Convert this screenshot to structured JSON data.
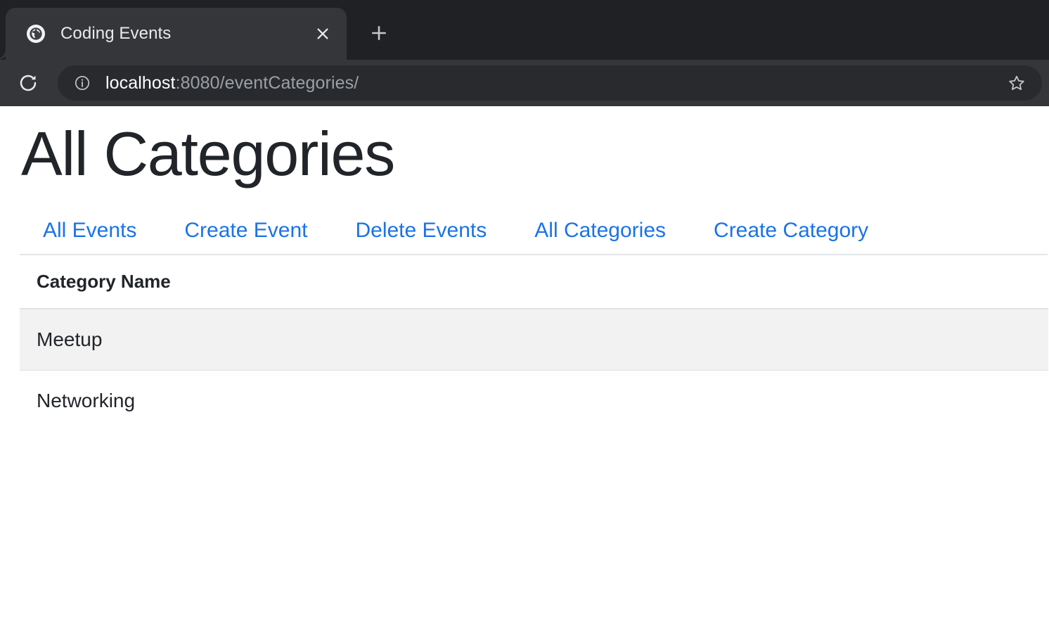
{
  "browser": {
    "tab": {
      "title": "Coding Events",
      "favicon_icon": "globe-icon",
      "close_icon": "close-icon"
    },
    "newtab_icon": "plus-icon",
    "reload_icon": "reload-icon",
    "omnibox": {
      "site_info_icon": "info-circle-icon",
      "url_host": "localhost",
      "url_rest": ":8080/eventCategories/",
      "bookmark_icon": "star-icon"
    }
  },
  "page": {
    "title": "All Categories",
    "nav": [
      {
        "label": "All Events"
      },
      {
        "label": "Create Event"
      },
      {
        "label": "Delete Events"
      },
      {
        "label": "All Categories"
      },
      {
        "label": "Create Category"
      }
    ],
    "table": {
      "columns": [
        "Category Name"
      ],
      "rows": [
        {
          "name": "Meetup"
        },
        {
          "name": "Networking"
        }
      ]
    }
  },
  "colors": {
    "link": "#1a73e8",
    "text": "#212529",
    "chrome_bg": "#202124",
    "toolbar_bg": "#35363a",
    "omnibox_bg": "#292a2d",
    "row_striped": "#f2f2f2",
    "border": "#dee2e6"
  }
}
